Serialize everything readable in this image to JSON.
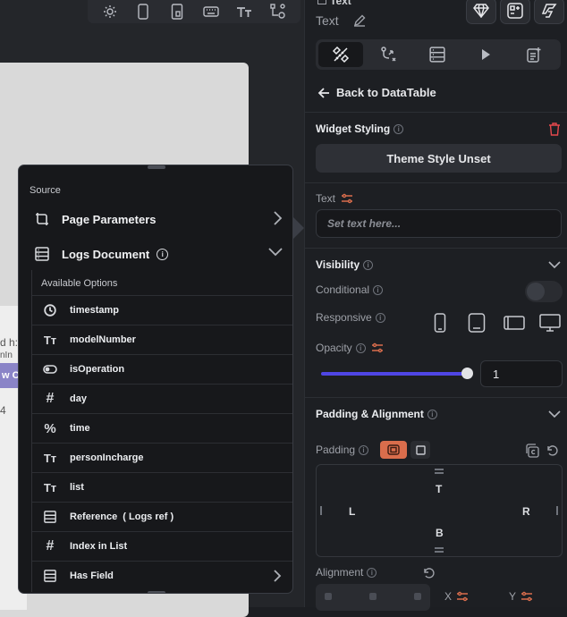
{
  "canvas": {
    "frame_text_1": "d h:",
    "frame_text_2": "nIn",
    "frame_button_text": "w C",
    "frame_text_3": "4"
  },
  "popup": {
    "source_label": "Source",
    "page_parameters": "Page Parameters",
    "logs_document": "Logs Document",
    "available_options": "Available Options",
    "options": [
      {
        "label": "timestamp",
        "icon": "clock-icon"
      },
      {
        "label": "modelNumber",
        "icon": "text-type-icon"
      },
      {
        "label": "isOperation",
        "icon": "toggle-icon"
      },
      {
        "label": "day",
        "icon": "hash-icon"
      },
      {
        "label": "time",
        "icon": "percent-icon"
      },
      {
        "label": "personIncharge",
        "icon": "text-type-icon"
      },
      {
        "label": "list",
        "icon": "text-type-icon"
      },
      {
        "label": "Reference  ( Logs ref )",
        "icon": "database-icon"
      },
      {
        "label": "Index in List",
        "icon": "hash-icon"
      },
      {
        "label": "Has Field",
        "icon": "database-icon"
      }
    ]
  },
  "panel": {
    "header_title": "Text",
    "header_subtitle": "Text",
    "back_label": "Back to DataTable",
    "widget_styling": "Widget Styling",
    "theme_button": "Theme Style Unset",
    "text_label": "Text",
    "text_placeholder": "Set text here...",
    "visibility": "Visibility",
    "conditional": "Conditional",
    "responsive": "Responsive",
    "opacity": "Opacity",
    "opacity_value": "1",
    "padding_alignment": "Padding & Alignment",
    "padding": "Padding",
    "pad_T": "T",
    "pad_L": "L",
    "pad_R": "R",
    "pad_B": "B",
    "alignment": "Alignment",
    "align_x": "X",
    "align_y": "Y",
    "accent_color": "#4f46e5",
    "active_padding_color": "#d96d4c",
    "delete_color": "#e5484d"
  }
}
